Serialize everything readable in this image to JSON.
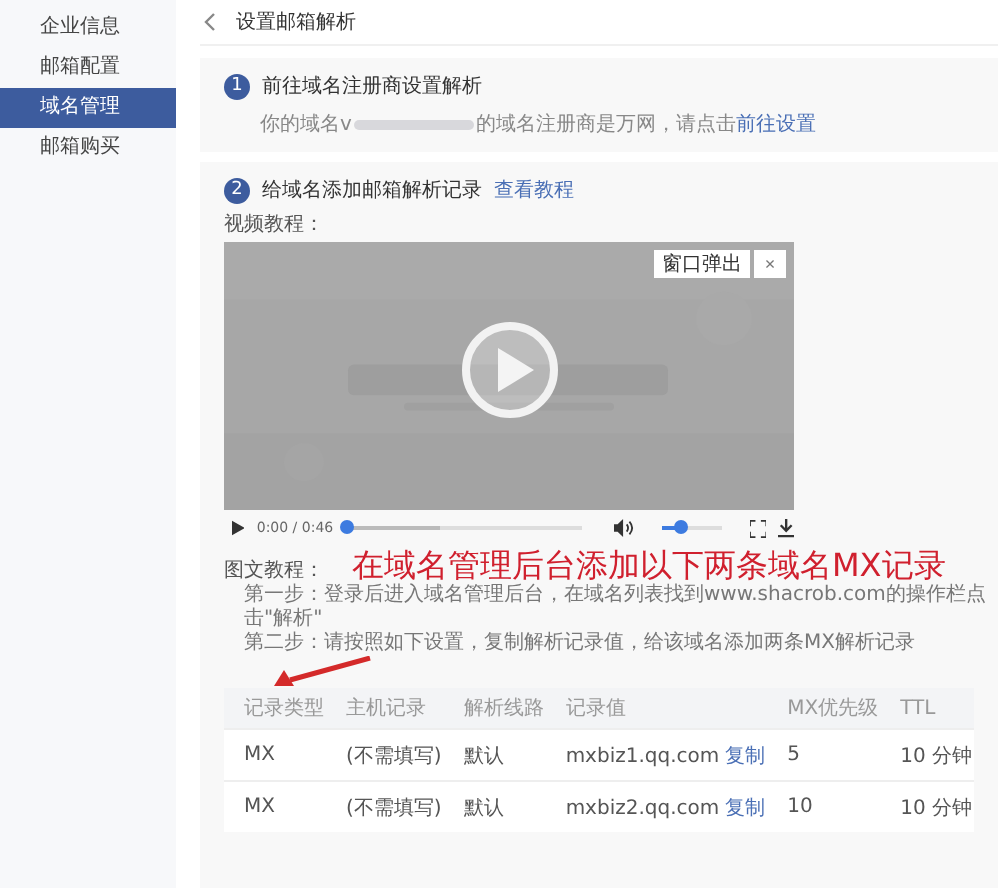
{
  "sidebar": {
    "items": [
      {
        "label": "企业信息",
        "selected": false
      },
      {
        "label": "邮箱配置",
        "selected": false
      },
      {
        "label": "域名管理",
        "selected": true
      },
      {
        "label": "邮箱购买",
        "selected": false
      }
    ]
  },
  "header": {
    "title": "设置邮箱解析"
  },
  "step_one": {
    "number": "1",
    "title": "前往域名注册商设置解析",
    "text_before": "你的域名v",
    "text_after": "的域名注册商是万网，请点击",
    "link": "前往设置"
  },
  "step_two": {
    "number": "2",
    "title": "给域名添加邮箱解析记录",
    "link": "查看教程",
    "video_label": "视频教程：",
    "video": {
      "kind": "picture",
      "popout_button": "窗口弹出",
      "close": "×",
      "time": "0:00 / 0:46",
      "progress": {
        "level": 0
      },
      "volume": {
        "level": 0.3
      }
    },
    "guide_label": "图文教程：",
    "annotation": "在域名管理后台添加以下两条域名MX记录",
    "guide_steps": [
      "第一步：登录后进入域名管理后台，在域名列表找到www.shacrob.com的操作栏点击\"解析\"",
      "第二步：请按照如下设置，复制解析记录值，给该域名添加两条MX解析记录"
    ],
    "table": {
      "columns": [
        "记录类型",
        "主机记录",
        "解析线路",
        "记录值",
        "MX优先级",
        "TTL"
      ],
      "rows": [
        {
          "type": "MX",
          "host": "(不需填写)",
          "line": "默认",
          "value": "mxbiz1.qq.com",
          "copy": "复制",
          "priority": "5",
          "ttl": "10 分钟"
        },
        {
          "type": "MX",
          "host": "(不需填写)",
          "line": "默认",
          "value": "mxbiz2.qq.com",
          "copy": "复制",
          "priority": "10",
          "ttl": "10 分钟"
        }
      ]
    }
  }
}
